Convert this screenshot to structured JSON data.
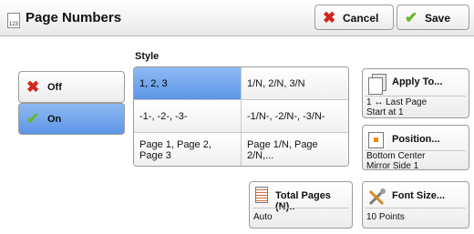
{
  "header": {
    "title": "Page Numbers",
    "title_icon_text": "123",
    "cancel_label": "Cancel",
    "save_label": "Save"
  },
  "style": {
    "label": "Style",
    "options": [
      {
        "label": "1, 2, 3",
        "selected": true
      },
      {
        "label": "1/N, 2/N, 3/N",
        "selected": false
      },
      {
        "label": "-1-, -2-, -3-",
        "selected": false
      },
      {
        "label": "-1/N-, -2/N-, -3/N-",
        "selected": false
      },
      {
        "label": "Page 1, Page 2, Page 3",
        "selected": false
      },
      {
        "label": "Page 1/N, Page 2/N,...",
        "selected": false
      }
    ]
  },
  "toggle": {
    "off_label": "Off",
    "on_label": "On",
    "selected": "On"
  },
  "apply_to": {
    "title": "Apply To...",
    "line1": "1 ↔ Last Page",
    "line2": "Start at 1"
  },
  "position": {
    "title": "Position...",
    "line1": "Bottom Center",
    "line2": "Mirror Side 1"
  },
  "total_pages": {
    "title": "Total Pages (N)..",
    "value": "Auto"
  },
  "font_size": {
    "title": "Font Size...",
    "value": "10 Points"
  },
  "colors": {
    "selected_blue": "#6fa3ec",
    "cancel_red": "#d0281c",
    "save_green": "#6ab52a"
  },
  "icons": [
    "page-numbers-icon",
    "cancel-x-icon",
    "save-check-icon",
    "document-stack-icon",
    "position-icon",
    "total-pages-icon",
    "font-size-tools-icon"
  ]
}
